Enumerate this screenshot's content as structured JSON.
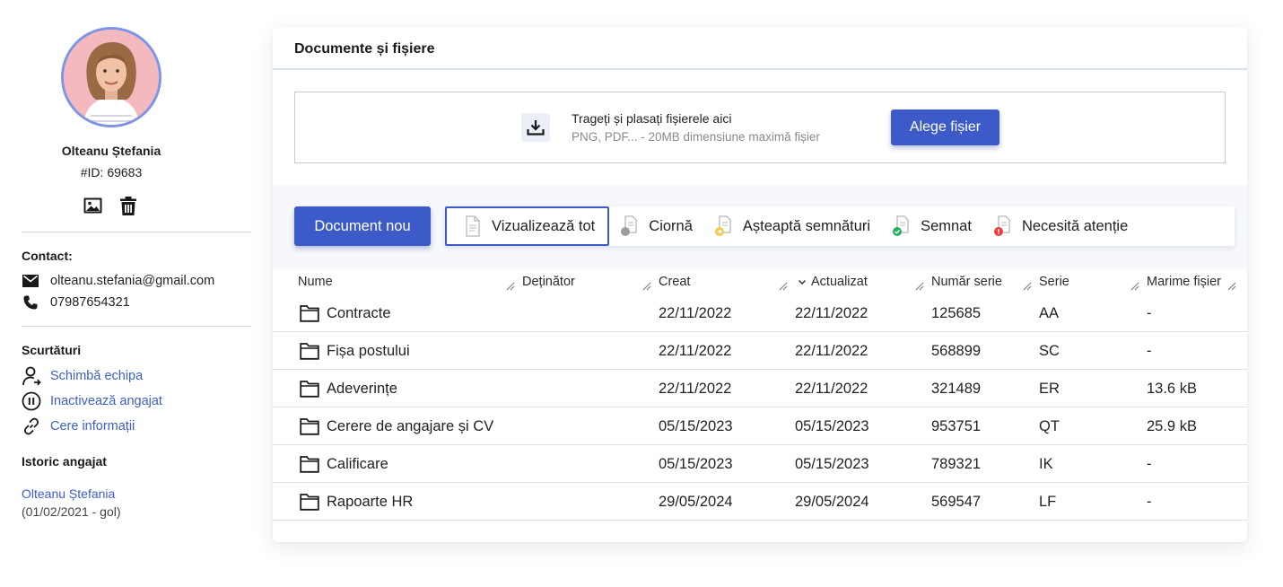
{
  "profile": {
    "name": "Olteanu Ștefania",
    "id_label": "#ID: 69683",
    "actions": {
      "photo_icon": "image-icon",
      "delete_icon": "trash-icon"
    }
  },
  "contact": {
    "title": "Contact:",
    "email": "olteanu.stefania@gmail.com",
    "phone": "07987654321"
  },
  "shortcuts": {
    "title": "Scurtături",
    "items": [
      {
        "label": "Schimbă echipa",
        "icon": "user-transfer-icon"
      },
      {
        "label": "Inactivează angajat",
        "icon": "pause-icon"
      },
      {
        "label": "Cere informații",
        "icon": "link-icon"
      }
    ]
  },
  "history": {
    "title": "Istoric angajat",
    "name": "Olteanu Ștefania",
    "dates": "(01/02/2021 - gol)"
  },
  "documents": {
    "title": "Documente și fișiere",
    "dropzone": {
      "main_text": "Trageți și plasați fișierele aici",
      "sub_text": "PNG, PDF... - 20MB dimensiune maximă fișier",
      "button": "Alege fișier"
    },
    "new_document": "Document nou",
    "filters": [
      {
        "label": "Vizualizează tot",
        "status_color": ""
      },
      {
        "label": "Ciornă",
        "status_color": "#9e9e9e"
      },
      {
        "label": "Așteaptă semnături",
        "status_color": "#f2c94c"
      },
      {
        "label": "Semnat",
        "status_color": "#27ae60"
      },
      {
        "label": "Necesită atenție",
        "status_color": "#eb3b3b"
      }
    ],
    "columns": [
      "Nume",
      "Deținător",
      "Creat",
      "Actualizat",
      "Număr serie",
      "Serie",
      "Marime fișier"
    ],
    "sorted_column": "Actualizat",
    "rows": [
      {
        "name": "Contracte",
        "owner": "",
        "created": "22/11/2022",
        "updated": "22/11/2022",
        "serial_no": "125685",
        "series": "AA",
        "size": "-"
      },
      {
        "name": "Fișa postului",
        "owner": "",
        "created": "22/11/2022",
        "updated": "22/11/2022",
        "serial_no": "568899",
        "series": "SC",
        "size": "-"
      },
      {
        "name": "Adeverințe",
        "owner": "",
        "created": "22/11/2022",
        "updated": "22/11/2022",
        "serial_no": "321489",
        "series": "ER",
        "size": "13.6 kB"
      },
      {
        "name": "Cerere de angajare și CV",
        "owner": "",
        "created": "05/15/2023",
        "updated": "05/15/2023",
        "serial_no": "953751",
        "series": "QT",
        "size": "25.9 kB"
      },
      {
        "name": "Calificare",
        "owner": "",
        "created": "05/15/2023",
        "updated": "05/15/2023",
        "serial_no": "789321",
        "series": "IK",
        "size": "-"
      },
      {
        "name": "Rapoarte HR",
        "owner": "",
        "created": "29/05/2024",
        "updated": "29/05/2024",
        "serial_no": "569547",
        "series": "LF",
        "size": "-"
      }
    ]
  },
  "colors": {
    "accent": "#3c5bc8",
    "link": "#3d5fc4",
    "avatar_ring": "#7c95e6"
  }
}
